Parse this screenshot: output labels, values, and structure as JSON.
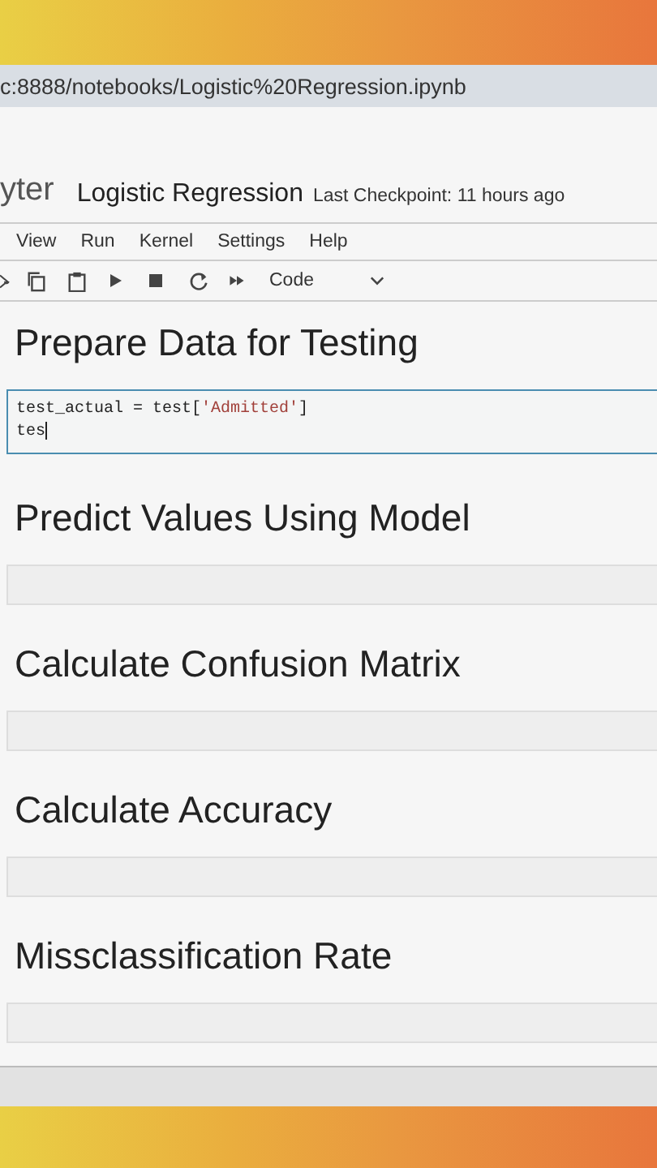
{
  "address_bar": {
    "url": "c:8888/notebooks/Logistic%20Regression.ipynb"
  },
  "header": {
    "logo_text": "yter",
    "title": "Logistic Regression",
    "checkpoint": "Last Checkpoint: 11 hours ago"
  },
  "menu": [
    "View",
    "Run",
    "Kernel",
    "Settings",
    "Help"
  ],
  "toolbar": {
    "cell_type": "Code"
  },
  "cells": [
    {
      "kind": "heading",
      "text": "Prepare Data for Testing"
    },
    {
      "kind": "code",
      "active": true,
      "lines": [
        [
          {
            "text": "test_actual = test[",
            "kind": "plain"
          },
          {
            "text": "'Admitted'",
            "kind": "string"
          },
          {
            "text": "]",
            "kind": "plain"
          }
        ],
        [
          {
            "text": "tes",
            "kind": "plain"
          }
        ]
      ]
    },
    {
      "kind": "heading",
      "text": "Predict Values Using Model"
    },
    {
      "kind": "code",
      "active": false
    },
    {
      "kind": "heading",
      "text": "Calculate Confusion Matrix"
    },
    {
      "kind": "code",
      "active": false
    },
    {
      "kind": "heading",
      "text": "Calculate Accuracy"
    },
    {
      "kind": "code",
      "active": false
    },
    {
      "kind": "heading",
      "text": "Missclassification Rate"
    },
    {
      "kind": "code",
      "active": false
    }
  ]
}
